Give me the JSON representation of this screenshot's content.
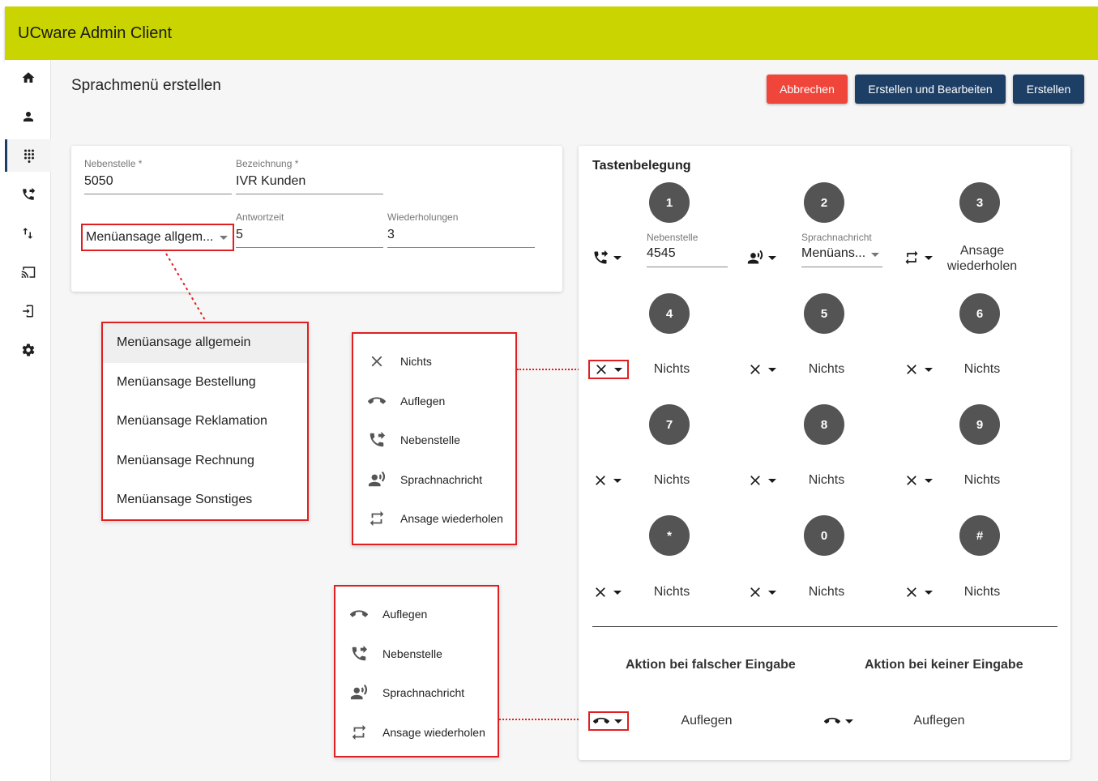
{
  "app": {
    "title": "UCware Admin Client"
  },
  "page": {
    "title": "Sprachmenü erstellen"
  },
  "buttons": {
    "cancel": "Abbrechen",
    "create_edit": "Erstellen und Bearbeiten",
    "create": "Erstellen"
  },
  "form": {
    "nebenstelle": {
      "label": "Nebenstelle *",
      "value": "5050"
    },
    "bezeichnung": {
      "label": "Bezeichnung *",
      "value": "IVR Kunden"
    },
    "menuansage": {
      "value": "Menüansage allgem..."
    },
    "antwortzeit": {
      "label": "Antwortzeit",
      "value": "5"
    },
    "wiederholungen": {
      "label": "Wiederholungen",
      "value": "3"
    }
  },
  "menuansage_options": [
    "Menüansage allgemein",
    "Menüansage Bestellung",
    "Menüansage Reklamation",
    "Menüansage Rechnung",
    "Menüansage Sonstiges"
  ],
  "action_menu_full": [
    "Nichts",
    "Auflegen",
    "Nebenstelle",
    "Sprachnachricht",
    "Ansage wiederholen"
  ],
  "action_menu_short": [
    "Auflegen",
    "Nebenstelle",
    "Sprachnachricht",
    "Ansage wiederholen"
  ],
  "keypad": {
    "title": "Tastenbelegung",
    "keys": [
      "1",
      "2",
      "3",
      "4",
      "5",
      "6",
      "7",
      "8",
      "9",
      "*",
      "0",
      "#"
    ],
    "k1": {
      "label": "Nebenstelle",
      "value": "4545"
    },
    "k2": {
      "label": "Sprachnachricht",
      "value": "Menüans..."
    },
    "k3": {
      "value": "Ansage wiederholen"
    },
    "nothing": "Nichts"
  },
  "fallback": {
    "wrong_title": "Aktion bei falscher Eingabe",
    "none_title": "Aktion bei keiner Eingabe",
    "wrong_value": "Auflegen",
    "none_value": "Auflegen"
  }
}
